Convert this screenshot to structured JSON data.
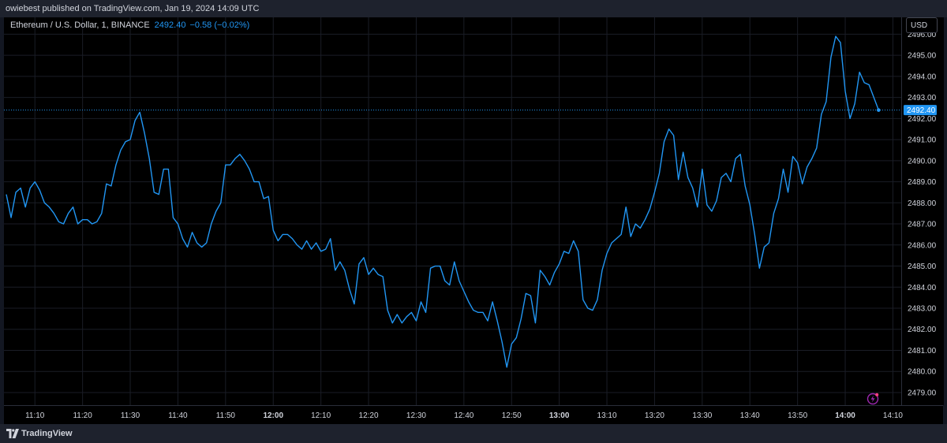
{
  "header": {
    "publish_text": "owiebest published on TradingView.com, Jan 19, 2024 14:09 UTC"
  },
  "legend": {
    "symbol": "Ethereum / U.S. Dollar, 1, BINANCE",
    "price": "2492.40",
    "change": "−0.58 (−0.02%)"
  },
  "price_axis": {
    "currency": "USD",
    "last_price_label": "2492.40"
  },
  "footer": {
    "brand": "TradingView"
  },
  "colors": {
    "line": "#2196f3",
    "background": "#000000",
    "grid": "#1a1d26",
    "axis_text": "#d1d4dc",
    "last_price_badge": "#2196f3"
  },
  "icons": {
    "brand": "tradingview-logo-icon",
    "flash": "lightning-icon"
  },
  "chart_data": {
    "type": "line",
    "title": "",
    "xlabel": "",
    "ylabel": "",
    "time_start": "11:04",
    "interval_minutes": 1,
    "ylim": [
      2478.4,
      2496.8
    ],
    "grid": true,
    "yticks": [
      "2479.00",
      "2480.00",
      "2481.00",
      "2482.00",
      "2483.00",
      "2484.00",
      "2485.00",
      "2486.00",
      "2487.00",
      "2488.00",
      "2489.00",
      "2490.00",
      "2491.00",
      "2492.00",
      "2493.00",
      "2494.00",
      "2495.00",
      "2496.00"
    ],
    "xticks": [
      {
        "label": "11:10",
        "bold": false
      },
      {
        "label": "11:20",
        "bold": false
      },
      {
        "label": "11:30",
        "bold": false
      },
      {
        "label": "11:40",
        "bold": false
      },
      {
        "label": "11:50",
        "bold": false
      },
      {
        "label": "12:00",
        "bold": true
      },
      {
        "label": "12:10",
        "bold": false
      },
      {
        "label": "12:20",
        "bold": false
      },
      {
        "label": "12:30",
        "bold": false
      },
      {
        "label": "12:40",
        "bold": false
      },
      {
        "label": "12:50",
        "bold": false
      },
      {
        "label": "13:00",
        "bold": true
      },
      {
        "label": "13:10",
        "bold": false
      },
      {
        "label": "13:20",
        "bold": false
      },
      {
        "label": "13:30",
        "bold": false
      },
      {
        "label": "13:40",
        "bold": false
      },
      {
        "label": "13:50",
        "bold": false
      },
      {
        "label": "14:00",
        "bold": true
      },
      {
        "label": "14:10",
        "bold": false
      }
    ],
    "last_value": 2492.4,
    "series": [
      {
        "values": [
          2488.4,
          2487.3,
          2488.5,
          2488.7,
          2487.8,
          2488.7,
          2489.0,
          2488.6,
          2488.0,
          2487.8,
          2487.5,
          2487.1,
          2487.0,
          2487.5,
          2487.8,
          2487.0,
          2487.2,
          2487.2,
          2487.0,
          2487.1,
          2487.5,
          2488.9,
          2488.8,
          2489.8,
          2490.5,
          2490.9,
          2491.0,
          2491.9,
          2492.3,
          2491.3,
          2490.1,
          2488.5,
          2488.4,
          2489.6,
          2489.6,
          2487.3,
          2487.0,
          2486.3,
          2485.9,
          2486.6,
          2486.1,
          2485.9,
          2486.1,
          2487.0,
          2487.6,
          2488.0,
          2489.8,
          2489.8,
          2490.1,
          2490.3,
          2490.0,
          2489.6,
          2489.0,
          2489.0,
          2488.2,
          2488.3,
          2486.7,
          2486.2,
          2486.5,
          2486.5,
          2486.3,
          2486.0,
          2485.8,
          2486.2,
          2485.8,
          2486.1,
          2485.7,
          2485.8,
          2486.3,
          2484.8,
          2485.2,
          2484.8,
          2483.9,
          2483.2,
          2485.1,
          2485.4,
          2484.6,
          2484.9,
          2484.6,
          2484.5,
          2482.9,
          2482.3,
          2482.7,
          2482.3,
          2482.6,
          2482.8,
          2482.4,
          2483.3,
          2482.8,
          2484.9,
          2485.0,
          2485.0,
          2484.3,
          2484.1,
          2485.2,
          2484.3,
          2483.8,
          2483.3,
          2482.9,
          2482.8,
          2482.8,
          2482.4,
          2483.3,
          2482.4,
          2481.4,
          2480.2,
          2481.3,
          2481.6,
          2482.5,
          2483.7,
          2483.6,
          2482.3,
          2484.8,
          2484.5,
          2484.1,
          2484.7,
          2485.1,
          2485.7,
          2485.6,
          2486.2,
          2485.7,
          2483.4,
          2483.0,
          2482.9,
          2483.4,
          2484.8,
          2485.6,
          2486.1,
          2486.3,
          2486.5,
          2487.8,
          2486.4,
          2487.0,
          2486.8,
          2487.2,
          2487.7,
          2488.5,
          2489.4,
          2490.9,
          2491.5,
          2491.2,
          2489.1,
          2490.4,
          2489.2,
          2488.7,
          2487.8,
          2489.6,
          2487.9,
          2487.6,
          2488.1,
          2489.2,
          2489.4,
          2489.0,
          2490.1,
          2490.3,
          2488.8,
          2487.9,
          2486.5,
          2484.9,
          2485.9,
          2486.1,
          2487.5,
          2488.2,
          2489.6,
          2488.5,
          2490.2,
          2489.9,
          2488.9,
          2489.7,
          2490.1,
          2490.6,
          2492.2,
          2492.8,
          2494.9,
          2495.9,
          2495.6,
          2493.3,
          2492.0,
          2492.7,
          2494.2,
          2493.7,
          2493.6,
          2493.0,
          2492.4
        ]
      }
    ]
  }
}
